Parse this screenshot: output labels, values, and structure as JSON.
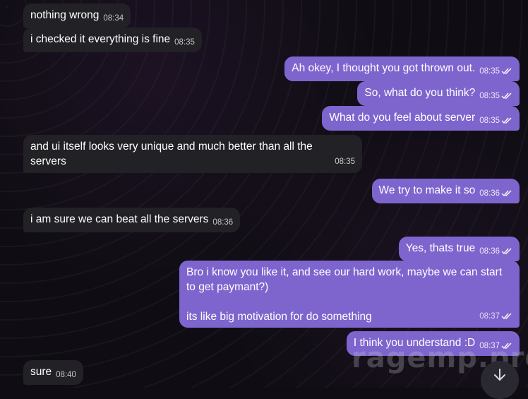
{
  "messages": [
    {
      "dir": "in",
      "text": "nothing wrong",
      "time": "08:34"
    },
    {
      "dir": "in",
      "text": "i checked it everything is fine",
      "time": "08:35"
    },
    {
      "dir": "out",
      "text": "Ah okey, I thought you got thrown out.",
      "time": "08:35"
    },
    {
      "dir": "out",
      "text": "So, what do you think?",
      "time": "08:35"
    },
    {
      "dir": "out",
      "text": "What do you feel about server",
      "time": "08:35"
    },
    {
      "dir": "in",
      "text": "and ui itself looks very unique and much better than all the servers",
      "time": "08:35"
    },
    {
      "dir": "out",
      "text": "We try to make it so",
      "time": "08:36"
    },
    {
      "dir": "in",
      "text": "i am sure we can beat all the servers",
      "time": "08:36"
    },
    {
      "dir": "out",
      "text": "Yes, thats true",
      "time": "08:36"
    },
    {
      "dir": "out",
      "text": "Bro i know you like it, and see our hard work, maybe we can start to get paymant?)",
      "text2": "its like big motivation for do something",
      "time": "08:37"
    },
    {
      "dir": "out",
      "text": "I think you understand :D",
      "time": "08:37"
    },
    {
      "dir": "in",
      "text": "sure",
      "time": "08:40"
    }
  ],
  "watermark": "ragemp.pro",
  "icons": {
    "read": "double-check-icon",
    "scroll": "arrow-down-icon"
  },
  "colors": {
    "incoming": "#222125",
    "outgoing": "#7e65ce",
    "background": "#0f0d13"
  }
}
